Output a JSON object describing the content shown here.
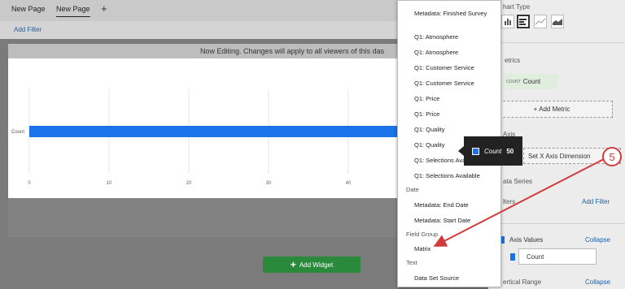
{
  "tabs": [
    {
      "label": "New Page"
    },
    {
      "label": "New Page"
    }
  ],
  "add_tab_glyph": "+",
  "filter_bar": {
    "add_filter": "Add Filter"
  },
  "notice": "Now Editing. Changes will apply to all viewers of this das",
  "chart_data": {
    "type": "bar",
    "orientation": "horizontal",
    "categories": [
      "Count"
    ],
    "values": [
      50
    ],
    "x_ticks": [
      "0",
      "10",
      "20",
      "30",
      "40"
    ],
    "xlim": [
      0,
      50
    ],
    "grid": true
  },
  "add_widget": "Add Widget",
  "right_panel": {
    "chart_type_label": "hart Type",
    "metrics_label": "etrics",
    "count_chip_small": "COUNT",
    "count_chip_label": "Count",
    "add_metric": "+ Add Metric",
    "axis_label": "Axis",
    "set_x_axis": "Set X Axis Dimension",
    "data_series_label": "ata Series",
    "filters_label": "lters",
    "add_filter": "Add Filter",
    "axis_values_label": "Axis Values",
    "collapse_1": "Collapse",
    "count_value": "Count",
    "vertical_range_label": "ertical Range",
    "collapse_2": "Collapse"
  },
  "dropdown": {
    "items": [
      "Metadata: Finished Survey",
      "Q1: Atmosphere",
      "Q1: Atmosphere",
      "Q1: Customer Service",
      "Q1: Customer Service",
      "Q1: Price",
      "Q1: Price",
      "Q1: Quality",
      "Q1: Quality",
      "Q1: Selections Ava",
      "Q1: Selections Available"
    ],
    "group_date": "Date",
    "date_items": [
      "Metadata: End Date",
      "Metadata: Start Date"
    ],
    "group_field": "Field Group",
    "field_items": [
      "Matrix"
    ],
    "group_text": "Text",
    "text_items": [
      "Data Set Source"
    ]
  },
  "tooltip": {
    "series": "Count",
    "value": "50"
  },
  "callout_number": "5",
  "colors": {
    "bar": "#1a73e8",
    "accent_green": "#2a8a3c",
    "callout_red": "#d23b3b",
    "link": "#1f5fa8"
  },
  "icons": [
    "plus-icon",
    "bar-chart-icon",
    "horizontal-bar-icon",
    "line-chart-icon",
    "area-chart-icon"
  ]
}
